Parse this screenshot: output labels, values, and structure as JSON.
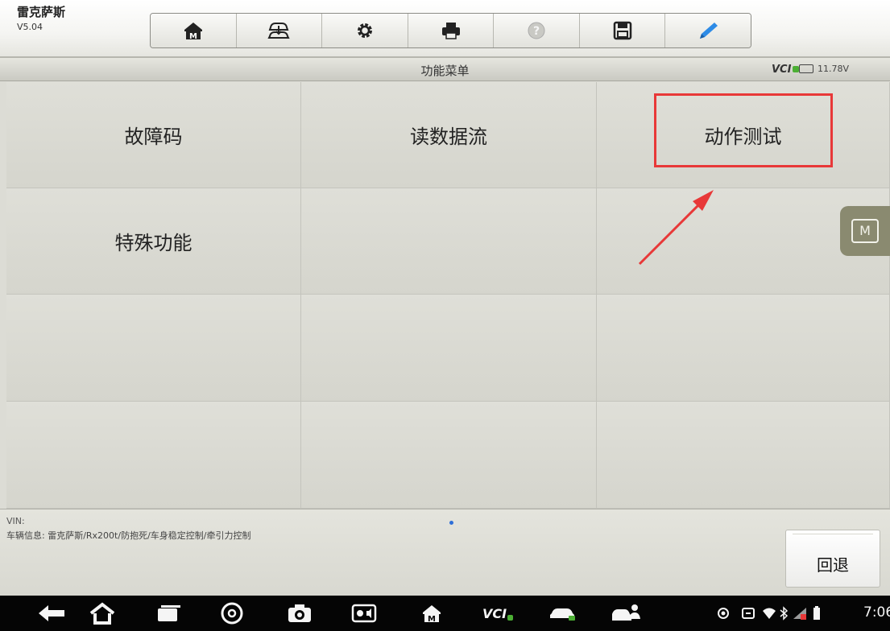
{
  "app": {
    "name": "雷克萨斯",
    "version": "V5.04"
  },
  "toolbar": {
    "items": [
      {
        "icon": "home-icon"
      },
      {
        "icon": "vehicle-swap-icon"
      },
      {
        "icon": "gear-icon"
      },
      {
        "icon": "printer-icon"
      },
      {
        "icon": "help-icon"
      },
      {
        "icon": "save-icon"
      },
      {
        "icon": "pen-icon"
      }
    ]
  },
  "title_bar": {
    "title": "功能菜单",
    "vci_label": "VCI",
    "battery_voltage": "11.78V"
  },
  "menu": {
    "rows": [
      [
        "故障码",
        "读数据流",
        "动作测试"
      ],
      [
        "特殊功能",
        "",
        ""
      ],
      [
        "",
        "",
        ""
      ],
      [
        "",
        "",
        ""
      ]
    ],
    "highlighted_item": "动作测试"
  },
  "floating_button": {
    "label": "M"
  },
  "footer": {
    "vin_label": "VIN:",
    "vehicle_info": "车辆信息: 雷克萨斯/Rx200t/防抱死/车身稳定控制/牵引力控制",
    "back_label": "回退"
  },
  "navbar": {
    "vci_label": "VCI",
    "time": "7:06"
  },
  "colors": {
    "highlight": "#e83838",
    "background": "#dcdcd5",
    "accent": "#2e6fd8"
  }
}
